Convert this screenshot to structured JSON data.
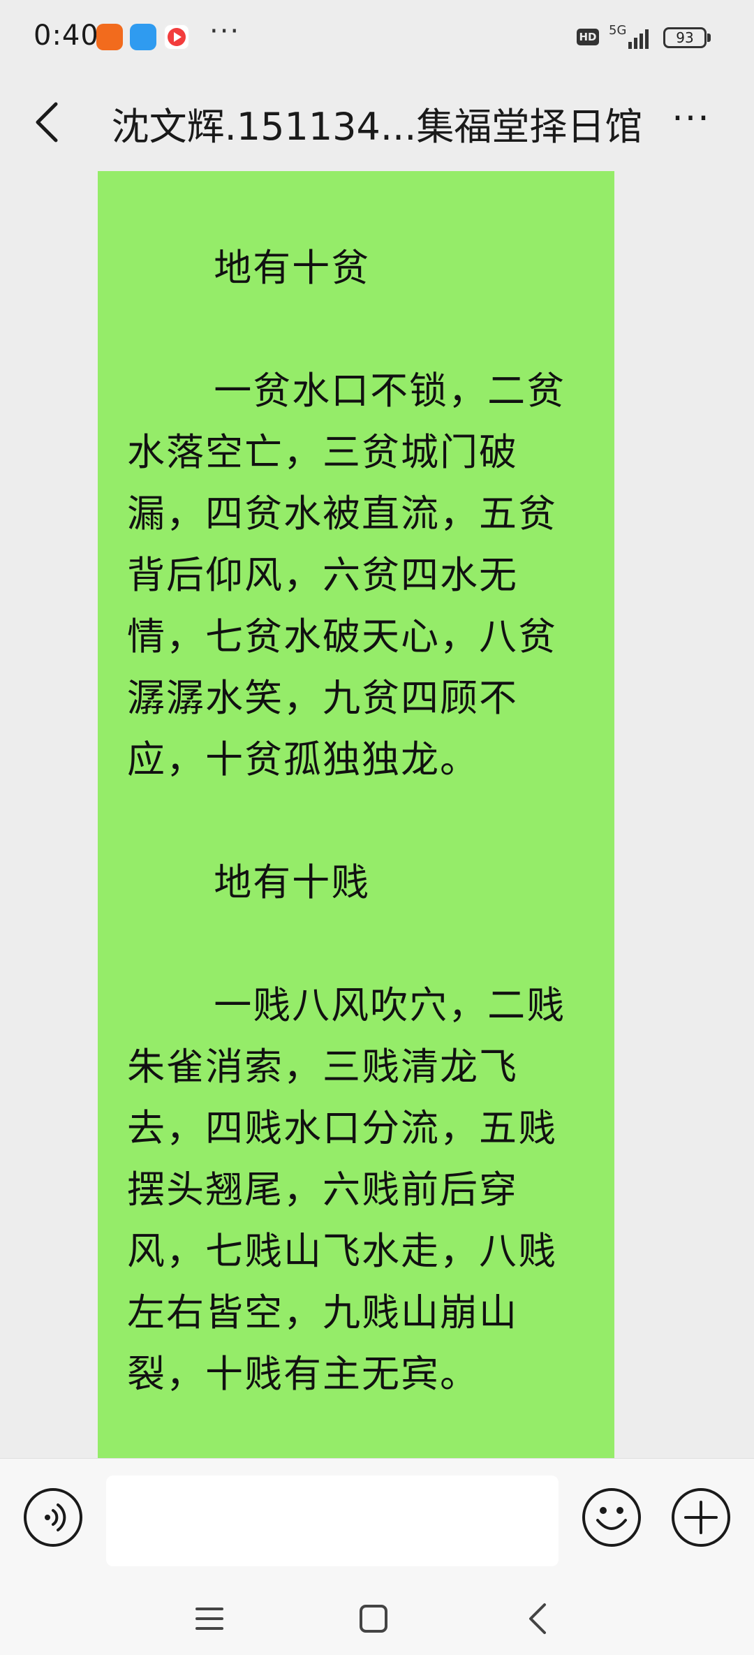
{
  "status_bar": {
    "time": "0:40",
    "hd": "HD",
    "network": "5G",
    "battery": "93",
    "more_dots": "···",
    "icons": [
      "app-icon-orange",
      "app-icon-blue",
      "app-icon-red"
    ]
  },
  "header": {
    "title": "沈文辉.151134...集福堂择日馆",
    "more_label": "···"
  },
  "message": {
    "paragraphs": [
      "地有十贫",
      "一贫水口不锁，二贫水落空亡，三贫城门破漏，四贫水被直流，五贫背后仰风，六贫四水无情，七贫水破天心，八贫潺潺水笑，九贫四顾不应，十贫孤独独龙。",
      "地有十贱",
      "一贱八风吹穴，二贱朱雀消索，三贱清龙飞去，四贱水口分流，五贱摆头翘尾，六贱前后穿风，七贱山飞水走，八贱左右皆空，九贱山崩山裂，十贱有主无宾。"
    ],
    "bubble_color": "#95ec69"
  },
  "input_bar": {
    "placeholder": ""
  },
  "colors": {
    "background": "#ededed",
    "bubble": "#95ec69",
    "bar": "#f7f7f7"
  }
}
